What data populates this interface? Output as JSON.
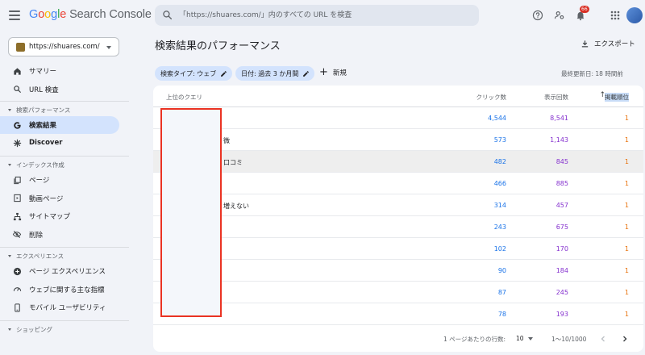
{
  "app": {
    "logo_google": "Google",
    "logo_rest": " Search Console",
    "search_placeholder": "「https://shuares.com/」内のすべての URL を検査",
    "notification_count": "66"
  },
  "sidebar": {
    "property_url": "https://shuares.com/",
    "top_items": [
      {
        "label": "サマリー",
        "icon": "home-icon"
      },
      {
        "label": "URL 検査",
        "icon": "search-icon"
      }
    ],
    "sections": [
      {
        "title": "検索パフォーマンス",
        "items": [
          {
            "label": "検索結果",
            "icon": "google-g-icon",
            "active": true
          },
          {
            "label": "Discover",
            "icon": "asterisk-icon"
          }
        ]
      },
      {
        "title": "インデックス作成",
        "items": [
          {
            "label": "ページ",
            "icon": "pages-icon"
          },
          {
            "label": "動画ページ",
            "icon": "video-page-icon"
          },
          {
            "label": "サイトマップ",
            "icon": "sitemap-icon"
          },
          {
            "label": "削除",
            "icon": "eye-off-icon"
          }
        ]
      },
      {
        "title": "エクスペリエンス",
        "items": [
          {
            "label": "ページ エクスペリエンス",
            "icon": "plus-circle-icon"
          },
          {
            "label": "ウェブに関する主な指標",
            "icon": "gauge-icon"
          },
          {
            "label": "モバイル ユーザビリティ",
            "icon": "mobile-icon"
          }
        ]
      },
      {
        "title": "ショッピング",
        "items": []
      }
    ]
  },
  "main": {
    "title": "検索結果のパフォーマンス",
    "export_label": "エクスポート",
    "filters": [
      {
        "label": "検索タイプ: ウェブ"
      },
      {
        "label": "日付: 過去 3 か月間"
      }
    ],
    "new_label": "新規",
    "last_updated": "最終更新日: 18 時間前"
  },
  "table": {
    "headers": {
      "query": "上位のクエリ",
      "clicks": "クリック数",
      "impressions": "表示回数",
      "position": "掲載順位"
    },
    "rows": [
      {
        "query": "",
        "clicks": "4,544",
        "impressions": "8,541",
        "position": "1"
      },
      {
        "query": "微",
        "clicks": "573",
        "impressions": "1,143",
        "position": "1"
      },
      {
        "query": "口コミ",
        "clicks": "482",
        "impressions": "845",
        "position": "1"
      },
      {
        "query": "",
        "clicks": "466",
        "impressions": "885",
        "position": "1"
      },
      {
        "query": "増えない",
        "clicks": "314",
        "impressions": "457",
        "position": "1"
      },
      {
        "query": "",
        "clicks": "243",
        "impressions": "675",
        "position": "1"
      },
      {
        "query": "",
        "clicks": "102",
        "impressions": "170",
        "position": "1"
      },
      {
        "query": "",
        "clicks": "90",
        "impressions": "184",
        "position": "1"
      },
      {
        "query": "",
        "clicks": "87",
        "impressions": "245",
        "position": "1"
      },
      {
        "query": "",
        "clicks": "78",
        "impressions": "193",
        "position": "1"
      }
    ],
    "footer": {
      "rows_per_page_label": "1 ページあたりの行数:",
      "rows_per_page_value": "10",
      "range": "1〜10/1000"
    }
  },
  "colors": {
    "clicks": "#1a73e8",
    "impressions": "#8430ce",
    "position": "#e8710a",
    "redaction_border": "#ea3323",
    "active_nav": "#d3e3fd"
  }
}
